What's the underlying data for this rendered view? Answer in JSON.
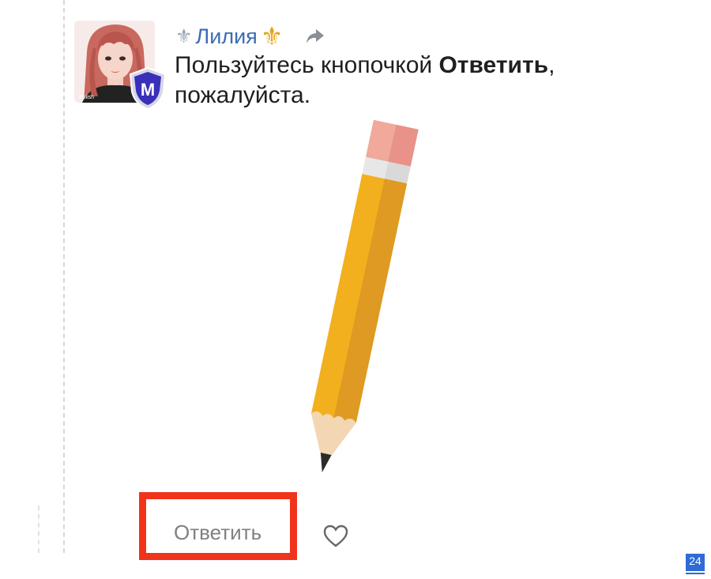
{
  "post": {
    "author": {
      "name": "Лилия",
      "prefix_icon": "fleur-de-lis-gray-icon",
      "suffix_icon": "fleur-de-lis-gold-icon",
      "badge_letter": "M",
      "avatar_caption": "Polish"
    },
    "message": {
      "part1": "Пользуйтесь кнопочкой ",
      "bold": "Ответить",
      "part2": ", пожалуйста."
    },
    "actions": {
      "reply_label": "Ответить",
      "like_icon": "heart-outline-icon",
      "share_icon": "share-arrow-icon"
    }
  },
  "corner_badge": {
    "text": "24"
  },
  "colors": {
    "username": "#3b6bb5",
    "highlight": "#f0341c",
    "badge": "#2e6bd6",
    "reply_text": "#808080"
  }
}
